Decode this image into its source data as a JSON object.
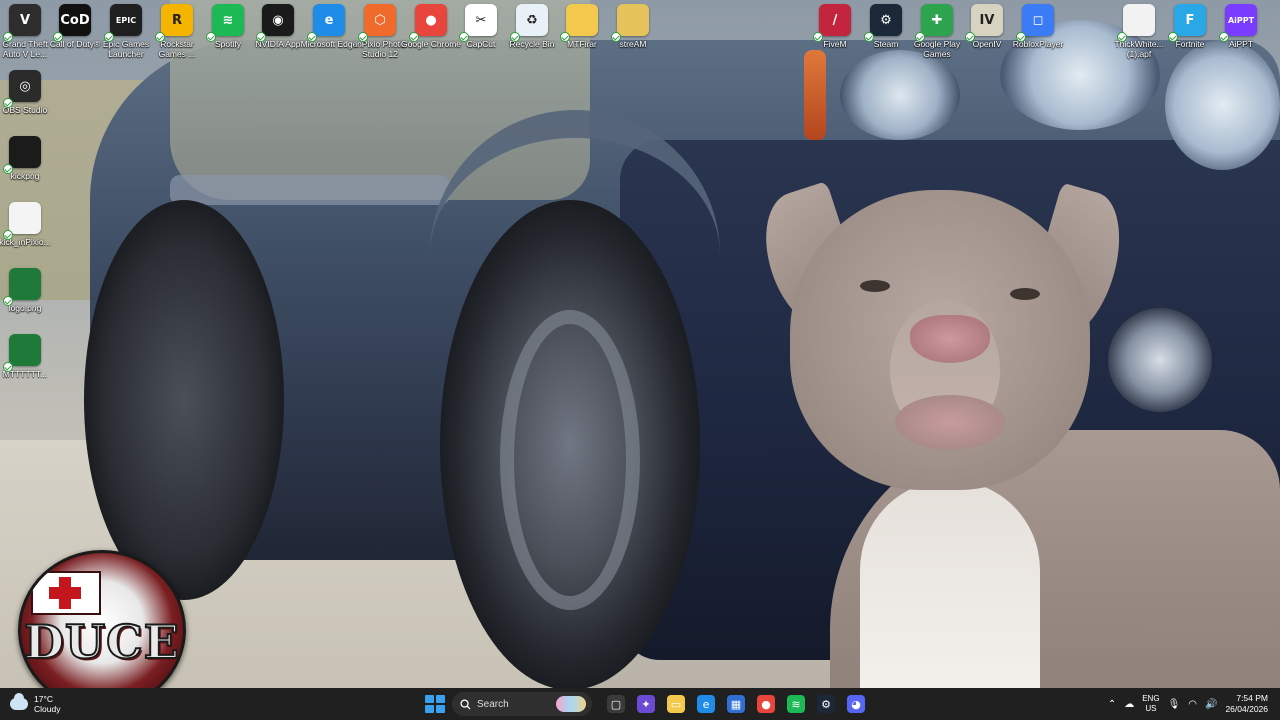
{
  "desktop": {
    "icons": [
      {
        "label": "Grand Theft Auto V Le...",
        "icon": "gta-icon",
        "color": "#2d2d2d",
        "glyph": "V"
      },
      {
        "label": "Call of Duty®",
        "icon": "call-of-duty-icon",
        "color": "#111111",
        "glyph": "CoD"
      },
      {
        "label": "Epic Games Launcher",
        "icon": "epic-games-icon",
        "color": "#1f1f1f",
        "glyph": "EPIC"
      },
      {
        "label": "Rockstar Games ...",
        "icon": "rockstar-icon",
        "color": "#f4b400",
        "glyph": "R"
      },
      {
        "label": "Spotify",
        "icon": "spotify-icon",
        "color": "#1db954",
        "glyph": "≋"
      },
      {
        "label": "NVIDIA App",
        "icon": "nvidia-icon",
        "color": "#1a1a1a",
        "glyph": "◉"
      },
      {
        "label": "Microsoft Edge",
        "icon": "edge-icon",
        "color": "#1f8de8",
        "glyph": "e"
      },
      {
        "label": "inPixio Photo Studio 12",
        "icon": "inpixio-icon",
        "color": "#f06a2c",
        "glyph": "⬡"
      },
      {
        "label": "Google Chrome",
        "icon": "chrome-icon",
        "color": "#e8453c",
        "glyph": "●"
      },
      {
        "label": "CapCut",
        "icon": "capcut-icon",
        "color": "#ffffff",
        "glyph": "✂"
      },
      {
        "label": "Recycle Bin",
        "icon": "recycle-bin-icon",
        "color": "#e8f1f8",
        "glyph": "♻"
      },
      {
        "label": "MTFirar",
        "icon": "folder-icon",
        "color": "#f2c94c",
        "glyph": ""
      },
      {
        "label": "streAM",
        "icon": "folder-icon",
        "color": "#e6c35a",
        "glyph": ""
      },
      {
        "label": "FiveM",
        "icon": "fivem-icon",
        "color": "#c2253d",
        "glyph": "/"
      },
      {
        "label": "Steam",
        "icon": "steam-icon",
        "color": "#1b2838",
        "glyph": "⚙"
      },
      {
        "label": "Google Play Games",
        "icon": "google-play-games-icon",
        "color": "#2ea44f",
        "glyph": "✚"
      },
      {
        "label": "OpenIV",
        "icon": "openiv-icon",
        "color": "#d8d2c0",
        "glyph": "IV"
      },
      {
        "label": "RobloxPlayer",
        "icon": "roblox-icon",
        "color": "#3b7bf6",
        "glyph": "◻"
      },
      {
        "label": "ThickWhite... (1).apf",
        "icon": "file-icon",
        "color": "#f2f2f2",
        "glyph": ""
      },
      {
        "label": "Fortnite",
        "icon": "fortnite-icon",
        "color": "#2aa7e6",
        "glyph": "F"
      },
      {
        "label": "AiPPT",
        "icon": "aippt-icon",
        "color": "#7a3cff",
        "glyph": "AiPPT"
      },
      {
        "label": "OBS Studio",
        "icon": "obs-icon",
        "color": "#2b2b2b",
        "glyph": "◎"
      },
      {
        "label": "kickpng",
        "icon": "image-file-icon",
        "color": "#1b1b1b",
        "glyph": ""
      },
      {
        "label": "kick_inPixio...",
        "icon": "image-file-icon",
        "color": "#f4f4f4",
        "glyph": ""
      },
      {
        "label": "logo.png",
        "icon": "image-file-icon",
        "color": "#1f7a3a",
        "glyph": ""
      },
      {
        "label": "MTTTTTT...",
        "icon": "image-file-icon",
        "color": "#1f7a3a",
        "glyph": ""
      }
    ]
  },
  "logo": {
    "text": "DUCE"
  },
  "taskbar": {
    "weather": {
      "temp": "17°C",
      "condition": "Cloudy"
    },
    "search_label": "Search",
    "apps": [
      {
        "icon": "task-view-icon",
        "color": "#3a3a3a",
        "glyph": "▢"
      },
      {
        "icon": "copilot-icon",
        "color": "#6b4bd6",
        "glyph": "✦"
      },
      {
        "icon": "file-explorer-icon",
        "color": "#f2c94c",
        "glyph": "▭"
      },
      {
        "icon": "edge-icon",
        "color": "#1f8de8",
        "glyph": "e"
      },
      {
        "icon": "microsoft-store-icon",
        "color": "#2f6fd6",
        "glyph": "▦"
      },
      {
        "icon": "chrome-icon",
        "color": "#e8453c",
        "glyph": "●"
      },
      {
        "icon": "spotify-icon",
        "color": "#1db954",
        "glyph": "≋"
      },
      {
        "icon": "steam-icon",
        "color": "#1b2838",
        "glyph": "⚙"
      },
      {
        "icon": "discord-icon",
        "color": "#5865f2",
        "glyph": "◕"
      }
    ],
    "tray": {
      "lang_top": "ENG",
      "lang_bottom": "US",
      "time": "7:54 PM",
      "date": "26/04/2026"
    }
  }
}
